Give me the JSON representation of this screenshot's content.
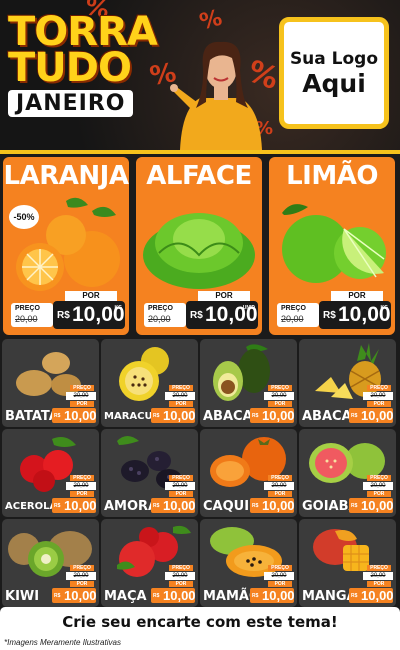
{
  "header": {
    "brand_line1": "TORRA",
    "brand_line2": "TUDO",
    "brand_line3": "JANEIRO",
    "logo_line1": "Sua Logo",
    "logo_line2": "Aqui",
    "pct": "%"
  },
  "colors": {
    "accent": "#f58220",
    "yellow": "#f6c21c",
    "card": "#3b3b3b",
    "background": "#1b1b1b"
  },
  "featured": [
    {
      "name": "LARANJA",
      "badge": "-50%",
      "por": "POR",
      "preco": "PREÇO",
      "old": "20,00",
      "currency": "R$",
      "price": "10,00",
      "unit": "KG"
    },
    {
      "name": "ALFACE",
      "por": "POR",
      "preco": "PREÇO",
      "old": "20,00",
      "currency": "R$",
      "price": "10,00",
      "unit": "UNID"
    },
    {
      "name": "LIMÃO",
      "por": "POR",
      "preco": "PREÇO",
      "old": "20,00",
      "currency": "R$",
      "price": "10,00",
      "unit": "KG"
    }
  ],
  "products": [
    {
      "name": "BATATA",
      "preco": "PREÇO",
      "old": "20,00",
      "por": "POR",
      "currency": "R$",
      "price": "10,00"
    },
    {
      "name": "MARACUJÁ",
      "preco": "PREÇO",
      "old": "20,00",
      "por": "POR",
      "currency": "R$",
      "price": "10,00"
    },
    {
      "name": "ABACATE",
      "preco": "PREÇO",
      "old": "20,00",
      "por": "POR",
      "currency": "R$",
      "price": "10,00"
    },
    {
      "name": "ABACAXI",
      "preco": "PREÇO",
      "old": "20,00",
      "por": "POR",
      "currency": "R$",
      "price": "10,00"
    },
    {
      "name": "ACEROLA",
      "preco": "PREÇO",
      "old": "20,00",
      "por": "POR",
      "currency": "R$",
      "price": "10,00"
    },
    {
      "name": "AMORA",
      "preco": "PREÇO",
      "old": "20,00",
      "por": "POR",
      "currency": "R$",
      "price": "10,00"
    },
    {
      "name": "CAQUI",
      "preco": "PREÇO",
      "old": "20,00",
      "por": "POR",
      "currency": "R$",
      "price": "10,00"
    },
    {
      "name": "GOIABA",
      "preco": "PREÇO",
      "old": "20,00",
      "por": "POR",
      "currency": "R$",
      "price": "10,00"
    },
    {
      "name": "KIWI",
      "preco": "PREÇO",
      "old": "20,00",
      "por": "POR",
      "currency": "R$",
      "price": "10,00"
    },
    {
      "name": "MAÇA",
      "preco": "PREÇO",
      "old": "20,00",
      "por": "POR",
      "currency": "R$",
      "price": "10,00"
    },
    {
      "name": "MAMÃO",
      "preco": "PREÇO",
      "old": "20,00",
      "por": "POR",
      "currency": "R$",
      "price": "10,00"
    },
    {
      "name": "MANGA",
      "preco": "PREÇO",
      "old": "20,00",
      "por": "POR",
      "currency": "R$",
      "price": "10,00"
    }
  ],
  "cta": "Crie seu encarte com este tema!",
  "disclaimer": "*Imagens Meramente Ilustrativas"
}
